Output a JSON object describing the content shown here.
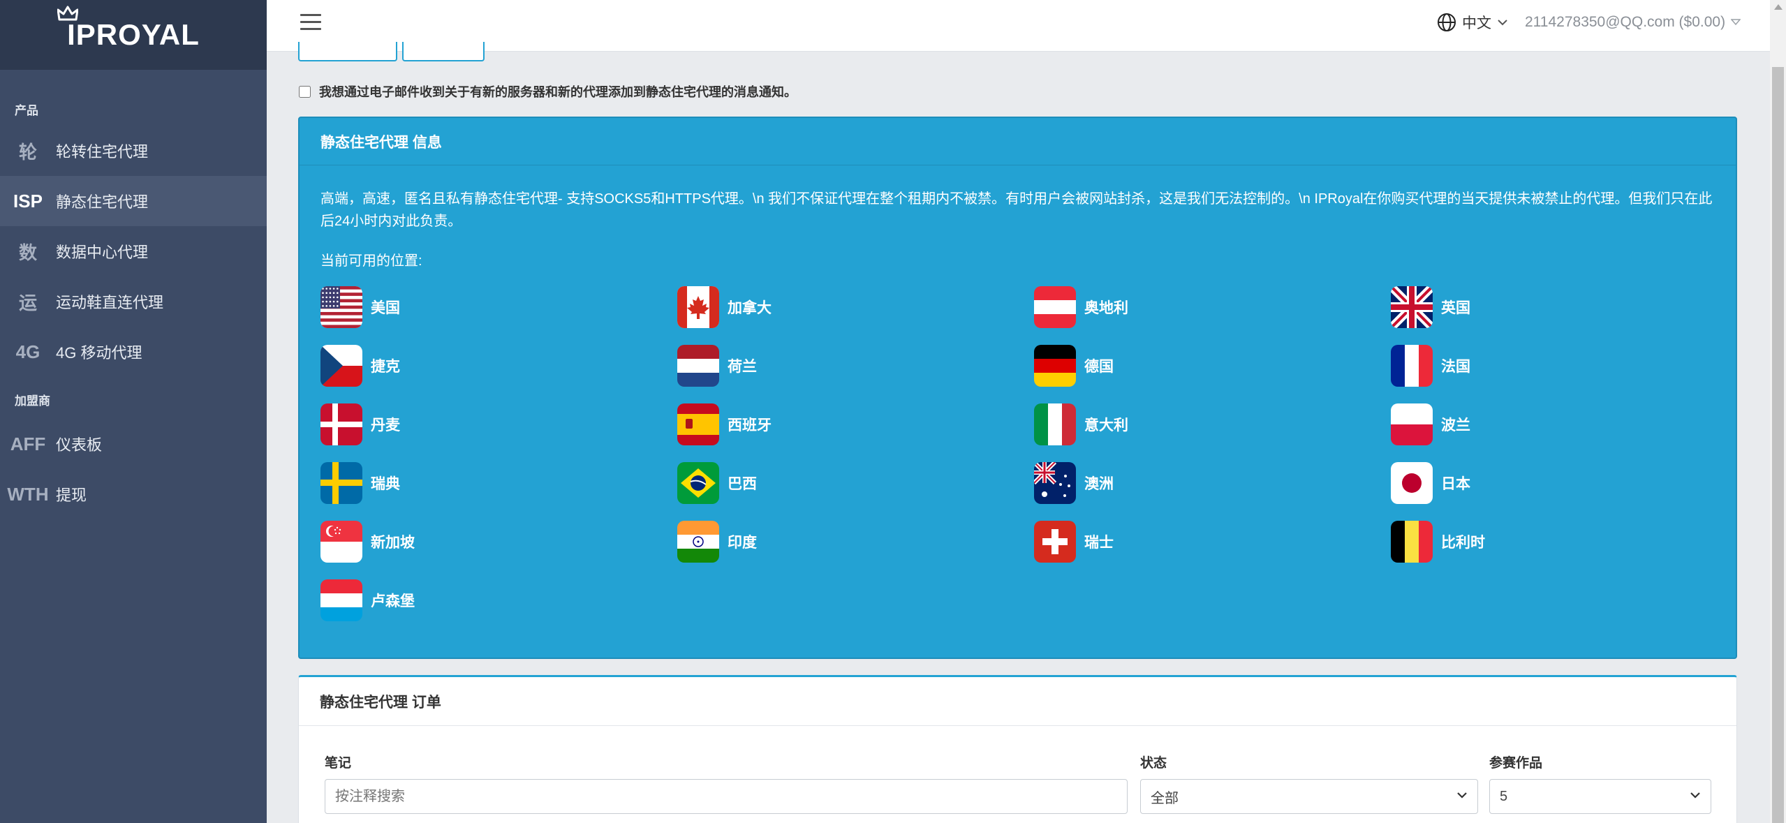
{
  "brand": {
    "logo_text": "IPROYAL"
  },
  "sidebar": {
    "section_products": "产品",
    "products": [
      {
        "abbr": "轮",
        "label": "轮转住宅代理",
        "active": false
      },
      {
        "abbr": "ISP",
        "label": "静态住宅代理",
        "active": true
      },
      {
        "abbr": "数",
        "label": "数据中心代理",
        "active": false
      },
      {
        "abbr": "运",
        "label": "运动鞋直连代理",
        "active": false
      },
      {
        "abbr": "4G",
        "label": "4G 移动代理",
        "active": false
      }
    ],
    "section_affiliate": "加盟商",
    "affiliate": [
      {
        "abbr": "AFF",
        "label": "仪表板"
      },
      {
        "abbr": "WTH",
        "label": "提现"
      }
    ]
  },
  "topbar": {
    "language": "中文",
    "account": "2114278350@QQ.com ($0.00)"
  },
  "consent": {
    "label": "我想通过电子邮件收到关于有新的服务器和新的代理添加到静态住宅代理的消息通知。"
  },
  "info": {
    "title": "静态住宅代理 信息",
    "description": "高端，高速，匿名且私有静态住宅代理- 支持SOCKS5和HTTPS代理。\\n 我们不保证代理在整个租期内不被禁。有时用户会被网站封杀，这是我们无法控制的。\\n IPRoyal在你购买代理的当天提供未被禁止的代理。但我们只在此后24小时内对此负责。",
    "locations_title": "当前可用的位置:",
    "locations": [
      {
        "name": "美国",
        "flag": "us-flag-icon"
      },
      {
        "name": "加拿大",
        "flag": "ca-flag-icon"
      },
      {
        "name": "奥地利",
        "flag": "at-flag-icon"
      },
      {
        "name": "英国",
        "flag": "gb-flag-icon"
      },
      {
        "name": "捷克",
        "flag": "cz-flag-icon"
      },
      {
        "name": "荷兰",
        "flag": "nl-flag-icon"
      },
      {
        "name": "德国",
        "flag": "de-flag-icon"
      },
      {
        "name": "法国",
        "flag": "fr-flag-icon"
      },
      {
        "name": "丹麦",
        "flag": "dk-flag-icon"
      },
      {
        "name": "西班牙",
        "flag": "es-flag-icon"
      },
      {
        "name": "意大利",
        "flag": "it-flag-icon"
      },
      {
        "name": "波兰",
        "flag": "pl-flag-icon"
      },
      {
        "name": "瑞典",
        "flag": "se-flag-icon"
      },
      {
        "name": "巴西",
        "flag": "br-flag-icon"
      },
      {
        "name": "澳洲",
        "flag": "au-flag-icon"
      },
      {
        "name": "日本",
        "flag": "jp-flag-icon"
      },
      {
        "name": "新加坡",
        "flag": "sg-flag-icon"
      },
      {
        "name": "印度",
        "flag": "in-flag-icon"
      },
      {
        "name": "瑞士",
        "flag": "ch-flag-icon"
      },
      {
        "name": "比利时",
        "flag": "be-flag-icon"
      },
      {
        "name": "卢森堡",
        "flag": "lu-flag-icon"
      }
    ]
  },
  "order": {
    "title": "静态住宅代理 订单",
    "note_label": "笔记",
    "note_placeholder": "按注释搜索",
    "status_label": "状态",
    "status_value": "全部",
    "entries_label": "参赛作品",
    "entries_value": "5"
  },
  "colors": {
    "accent": "#23a2d3",
    "sidebar": "#3d4b66",
    "sidebar_brand": "#2d394f"
  }
}
